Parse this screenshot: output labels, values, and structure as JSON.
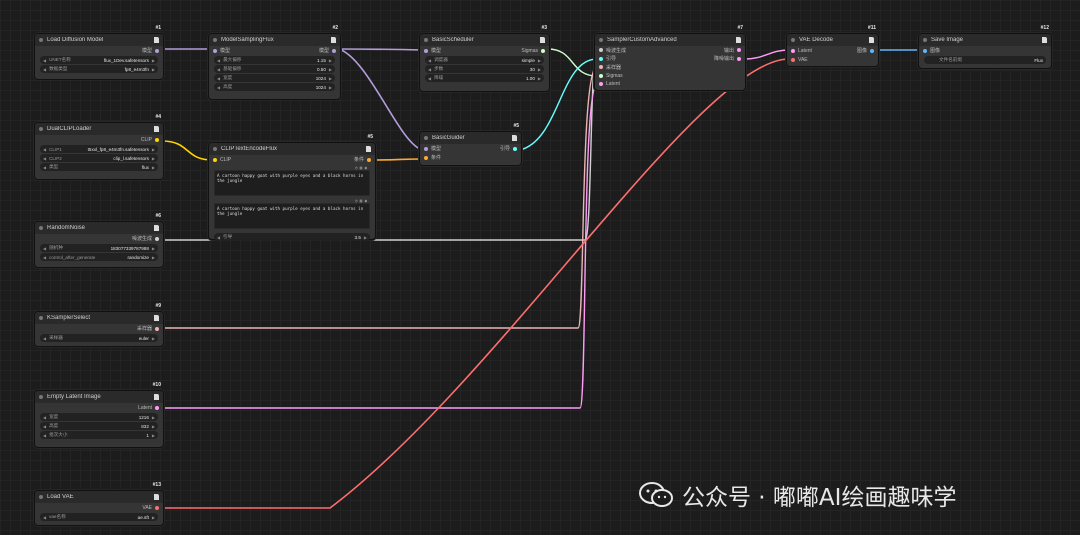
{
  "colors": {
    "model": "#b39ddb",
    "clip": "#ffd500",
    "conditioning": "#ffa931",
    "latent": "#ff9cf9",
    "vae": "#ff6e6e",
    "image": "#64b5f6",
    "noise": "#d0d0d0",
    "sampler": "#ecb4b4",
    "sigmas": "#cdffcd",
    "guider": "#66ffff"
  },
  "nodes": {
    "n1": {
      "id": "#1",
      "title": "Load Diffusion Model",
      "out_model": "模型",
      "w1": {
        "label": "UNET名称",
        "value": "flux_1Dev.safetensors"
      },
      "w2": {
        "label": "数据类型",
        "value": "fp8_e4m3fn"
      }
    },
    "n2": {
      "id": "#2",
      "title": "ModelSamplingFlux",
      "in_model": "模型",
      "out_model": "模型",
      "w1": {
        "label": "最大偏移",
        "value": "1.15"
      },
      "w2": {
        "label": "基础偏移",
        "value": "0.50"
      },
      "w3": {
        "label": "宽度",
        "value": "1024"
      },
      "w4": {
        "label": "高度",
        "value": "1024"
      }
    },
    "n3": {
      "id": "#3",
      "title": "BasicScheduler",
      "in_model": "模型",
      "out_sigmas": "Sigmas",
      "w1": {
        "label": "调度器",
        "value": "simple"
      },
      "w2": {
        "label": "步数",
        "value": "30"
      },
      "w3": {
        "label": "降噪",
        "value": "1.00"
      }
    },
    "n4": {
      "id": "#4",
      "title": "DualCLIPLoader",
      "out_clip": "CLIP",
      "w1": {
        "label": "CLIP1",
        "value": "t5xxl_fp8_e4m3fn.safetensors"
      },
      "w2": {
        "label": "CLIP2",
        "value": "clip_l.safetensors"
      },
      "w3": {
        "label": "类型",
        "value": "flux"
      }
    },
    "n5": {
      "id": "#5",
      "title": "CLIPTextEncodeFlux",
      "in_clip": "CLIP",
      "out_cond": "条件",
      "text1": "A cartoon happy goat with purple eyes and a black horns in the jungle",
      "text2": "A cartoon happy goat with purple eyes and a black horns in the jungle",
      "w1": {
        "label": "引导",
        "value": "3.5"
      }
    },
    "n5b": {
      "id": "#5",
      "title": "BasicGuider",
      "in_model": "模型",
      "in_cond": "条件",
      "out_guider": "引导"
    },
    "n6": {
      "id": "#6",
      "title": "RandomNoise",
      "out_noise": "噪波生成",
      "w1": {
        "label": "随机种",
        "value": "183077339787988"
      },
      "w2": {
        "label": "control_after_generate",
        "value": "randomize"
      }
    },
    "n7": {
      "id": "#7",
      "title": "SamplerCustomAdvanced",
      "in_noise": "噪波生成",
      "in_guider": "引导",
      "in_sampler": "采样器",
      "in_sigmas": "Sigmas",
      "in_latent": "Latent",
      "out1": "输出",
      "out2": "降噪输出"
    },
    "n9": {
      "id": "#9",
      "title": "KSamplerSelect",
      "out_sampler": "采样器",
      "w1": {
        "label": "采样器",
        "value": "euler"
      }
    },
    "n10": {
      "id": "#10",
      "title": "Empty Latent Image",
      "out_latent": "Latent",
      "w1": {
        "label": "宽度",
        "value": "1216"
      },
      "w2": {
        "label": "高度",
        "value": "832"
      },
      "w3": {
        "label": "批次大小",
        "value": "1"
      }
    },
    "n11": {
      "id": "#11",
      "title": "VAE Decode",
      "in_latent": "Latent",
      "in_vae": "VAE",
      "out_image": "图像"
    },
    "n12": {
      "id": "#12",
      "title": "Save Image",
      "in_image": "图像",
      "w1": {
        "label": "文件名前缀",
        "value": "Flux"
      }
    },
    "n13": {
      "id": "#13",
      "title": "Load VAE",
      "out_vae": "VAE",
      "w1": {
        "label": "vae名称",
        "value": "ae.sft"
      }
    }
  },
  "watermark": {
    "text": "公众号 · 嘟嘟AI绘画趣味学"
  }
}
